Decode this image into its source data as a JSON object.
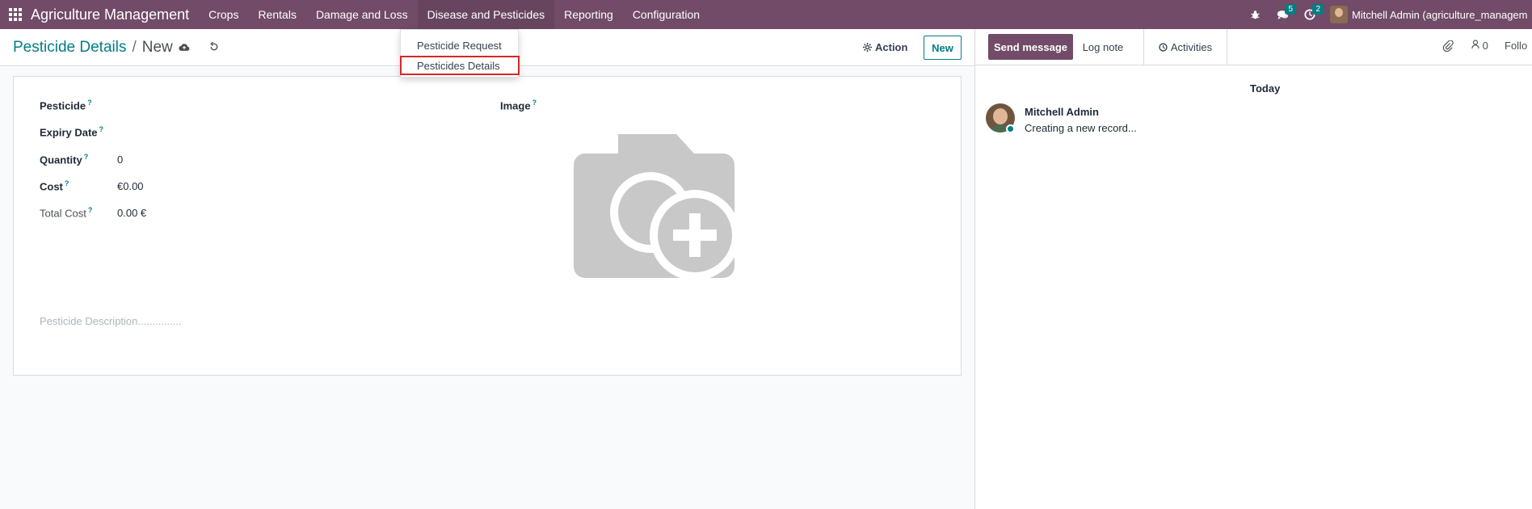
{
  "navbar": {
    "brand": "Agriculture Management",
    "menu": [
      "Crops",
      "Rentals",
      "Damage and Loss",
      "Disease and Pesticides",
      "Reporting",
      "Configuration"
    ],
    "messages_count": "5",
    "activities_count": "2",
    "user": "Mitchell Admin (agriculture_managem"
  },
  "dropdown": {
    "items": [
      "Pesticide Request",
      "Pesticides Details"
    ]
  },
  "control": {
    "breadcrumb_parent": "Pesticide Details",
    "breadcrumb_sep": "/",
    "breadcrumb_current": "New",
    "action_label": "Action",
    "new_label": "New"
  },
  "form": {
    "fields": [
      {
        "label": "Pesticide",
        "value": ""
      },
      {
        "label": "Expiry Date",
        "value": ""
      },
      {
        "label": "Quantity",
        "value": "0"
      },
      {
        "label": "Cost",
        "value": "€0.00"
      },
      {
        "label": "Total Cost",
        "value": "0.00 €"
      }
    ],
    "image_label": "Image",
    "help_mark": "?",
    "description_placeholder": "Pesticide Description..............."
  },
  "chatter": {
    "send_message": "Send message",
    "log_note": "Log note",
    "activities": "Activities",
    "followers_count": "0",
    "follow_label": "Follo",
    "date_separator": "Today",
    "message": {
      "author": "Mitchell Admin",
      "body": "Creating a new record..."
    }
  },
  "colors": {
    "brand": "#714B67",
    "accent": "#017e84",
    "highlight": "#d62828"
  }
}
